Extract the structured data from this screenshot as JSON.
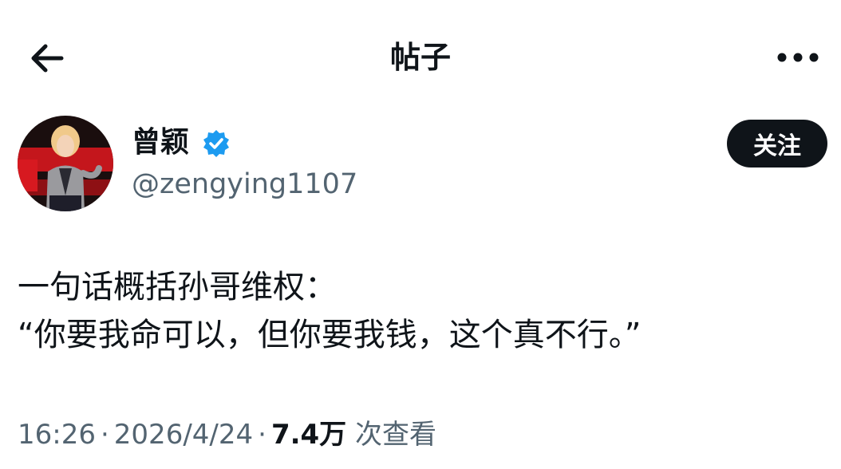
{
  "header": {
    "title": "帖子",
    "back_icon": "arrow-left-icon",
    "more_icon": "more-horizontal-icon"
  },
  "author": {
    "name": "曾颖",
    "handle": "@zengying1107",
    "verified_icon": "verified-badge-icon",
    "avatar_icon": "avatar",
    "follow_label": "关注"
  },
  "post": {
    "line1": "一句话概括孙哥维权：",
    "line2": "“你要我命可以，但你要我钱，这个真不行。”"
  },
  "meta": {
    "time": "16:26",
    "separator": "·",
    "date": "2026/4/24",
    "views_count": "7.4万",
    "views_label": "次查看"
  },
  "colors": {
    "text_primary": "#0f1419",
    "text_secondary": "#536471",
    "verified_blue": "#1d9bf0",
    "button_bg": "#0f1419"
  }
}
